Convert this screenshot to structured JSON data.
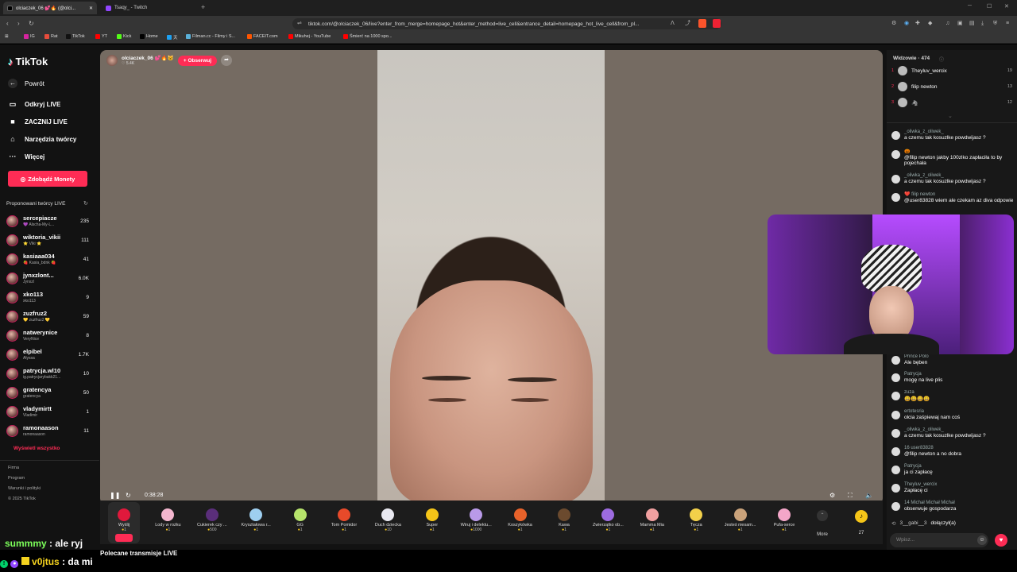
{
  "browser": {
    "tabs": [
      {
        "label": "olciaczek_06 💕🔥 (@olci..."
      },
      {
        "label": "Tsaqy_ - Twitch"
      }
    ],
    "url": "tiktok.com/@olciaczek_06/live?enter_from_merge=homepage_hot&enter_method=live_cell&entrance_detail=homepage_hot_live_cell&from_pl...",
    "bookmarks": [
      "IG",
      "Rat",
      "TikTok",
      "YT",
      "Kick",
      "Home",
      "天",
      "Filman.cc - Filmy i S...",
      "FACEIT.com",
      "Mikuhej - YouTube",
      "Śmierć na 1000 spo..."
    ],
    "bookmark_colors": [
      "#d6249f",
      "#e74c3c",
      "#111111",
      "#ff0000",
      "#53fc18",
      "#000000",
      "#1da1f2",
      "#5ab0d8",
      "#ff5500",
      "#ff0000",
      "#ff0000"
    ]
  },
  "sidebar": {
    "logo": "TikTok",
    "back": "Powrót",
    "nav": [
      "Odkryj LIVE",
      "ZACZNIJ LIVE",
      "Narzędzia twórcy",
      "Więcej"
    ],
    "coins_button": "Zdobądź Monety",
    "section_title": "Proponowani twórcy LIVE",
    "creators": [
      {
        "name": "sercepiacze",
        "sub": "💜 Alscha-My-L...",
        "count": "235"
      },
      {
        "name": "wiktoria_vikii",
        "sub": "⭐ Viki ⭐",
        "count": "111"
      },
      {
        "name": "kasiaaa034",
        "sub": "🍓 Kasia_bdnk 🍓",
        "count": "41"
      },
      {
        "name": "jynxzlont...",
        "sub": "Jynxzl",
        "count": "6.0K"
      },
      {
        "name": "xko113",
        "sub": "xko113",
        "count": "9"
      },
      {
        "name": "zuzfruz2",
        "sub": "💛 zuzfruz2 💛",
        "count": "59"
      },
      {
        "name": "natwerynice",
        "sub": "VeryNice",
        "count": "8"
      },
      {
        "name": "elpibel",
        "sub": "Alyssa",
        "count": "1.7K"
      },
      {
        "name": "patrycja.wl10",
        "sub": "ig.patrycjarybakk21...",
        "count": "10"
      },
      {
        "name": "gratencya",
        "sub": "gratencya",
        "count": "50"
      },
      {
        "name": "vladymirtt",
        "sub": "Vladimir",
        "count": "1"
      },
      {
        "name": "ramonaason",
        "sub": "ramonaason",
        "count": "11"
      }
    ],
    "see_all": "Wyświetl wszystko",
    "footer": [
      "Firma",
      "Program",
      "Warunki i polityki",
      "© 2025 TikTok"
    ]
  },
  "video": {
    "host_name": "olciaczek_06 💕🔥🐱",
    "host_likes": "♡ 5.4K",
    "follow_label": "+ Obserwuj",
    "elapsed": "0:38:28"
  },
  "gifts": [
    {
      "name": "Wyślij",
      "price": "1",
      "color": "#e0193c",
      "icon": "rose-icon"
    },
    {
      "name": "Lody w rożku",
      "price": "1",
      "color": "#f3b7cf",
      "icon": "ice-cream-icon"
    },
    {
      "name": "Cukierek czy ...",
      "price": "500",
      "color": "#5a2e7a",
      "icon": "candy-icon"
    },
    {
      "name": "Kryształowa r...",
      "price": "1",
      "color": "#9ecff0",
      "icon": "crystal-icon"
    },
    {
      "name": "GG",
      "price": "1",
      "color": "#b6e36b",
      "icon": "gg-icon"
    },
    {
      "name": "Tom Pomidor",
      "price": "1",
      "color": "#e84a2a",
      "icon": "tomato-icon"
    },
    {
      "name": "Duch dziecka",
      "price": "10",
      "color": "#e8e8f0",
      "icon": "ghost-icon"
    },
    {
      "name": "Super",
      "price": "1",
      "color": "#f5c518",
      "icon": "super-icon"
    },
    {
      "name": "Wiruj i delektu...",
      "price": "1000",
      "color": "#b99ae8",
      "icon": "spin-icon"
    },
    {
      "name": "Koszykówka",
      "price": "1",
      "color": "#e8622a",
      "icon": "basketball-icon"
    },
    {
      "name": "Kawa",
      "price": "1",
      "color": "#6b4a2e",
      "icon": "coffee-icon"
    },
    {
      "name": "Zwierzątko ob...",
      "price": "1",
      "color": "#9d6be0",
      "icon": "pet-icon"
    },
    {
      "name": "Mamma Mia",
      "price": "1",
      "color": "#f0a0a0",
      "icon": "hand-icon"
    },
    {
      "name": "Tęcza",
      "price": "1",
      "color": "#f2d04a",
      "icon": "rainbow-icon"
    },
    {
      "name": "Jesteś niesam...",
      "price": "1",
      "color": "#c9a27a",
      "icon": "cat-icon"
    },
    {
      "name": "Pufa-serce",
      "price": "1",
      "color": "#f3a6c8",
      "icon": "heart-icon"
    }
  ],
  "gift_more": "More",
  "gift_coins": "27",
  "recommended": "Polecane transmisje LIVE",
  "viewers": {
    "title": "Widzowie · 474",
    "list": [
      {
        "rank": "1",
        "name": "Theyluv_wercix",
        "count": "19"
      },
      {
        "rank": "2",
        "name": "filip newton",
        "count": "13"
      },
      {
        "rank": "3",
        "name": "🦓",
        "count": "12"
      }
    ]
  },
  "chat": [
    {
      "name": "_oliwka_z_oliwek_",
      "text": "a czemu tak kosuzlke powdwijasz ?"
    },
    {
      "name": "🎃",
      "text": "@filip newton jakby 100zlko zapłaciła to by pojechała"
    },
    {
      "name": "_oliwka_z_oliwek_",
      "text": "a czemu tak kosuzlke powdwijasz ?"
    },
    {
      "name": "❤️ filip newton",
      "text": "@user83828 wiem ale czekam az diva odpowie"
    },
    {
      "name": "Prince Polo",
      "text": "Ale bęben"
    },
    {
      "name": "Patrycja",
      "text": "mogę na live plis"
    },
    {
      "name": "zuza",
      "text": "😀😀😀😀"
    },
    {
      "name": "ertotesria",
      "text": "olcia zaśpiewaj nam coś"
    },
    {
      "name": "_oliwka_z_oliwek_",
      "text": "a czemu tak kosuzlke powdwijasz ?"
    },
    {
      "name": "16 user83828",
      "text": "@filip newton a no dobra"
    },
    {
      "name": "Patrycja",
      "text": "ja ci zapłacę"
    },
    {
      "name": "Theyluv_wercix",
      "text": "Zapłacę ci"
    },
    {
      "name": "14 Michał Michał Michał",
      "text": "obserwuje gospodarza"
    }
  ],
  "joined": {
    "name": "3__gabi__3",
    "text": "dołączył(a)"
  },
  "chat_input_placeholder": "Wpisz...",
  "twitch_chat": [
    {
      "user": "summmy",
      "text": ": ale ryj",
      "color": "#7cff5a"
    },
    {
      "user": "v0jtus",
      "text": ": da mi",
      "color": "#f5d31f"
    }
  ]
}
